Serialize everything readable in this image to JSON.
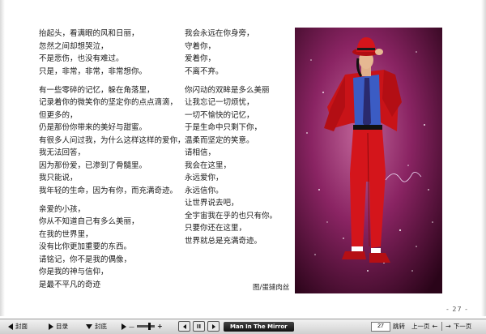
{
  "left_column": [
    [
      "抬起头，看满眼的风和日丽，",
      "忽然之间却想哭泣，",
      "不是悲伤，也没有难过。",
      "只是，非常，非常，非常想你。"
    ],
    [
      "有一些零碎的记忆，躲在角落里，",
      "记录着你的微笑你的坚定你的点点滴滴，",
      "但更多的，",
      "仍是那份你带来的美好与甜蜜。",
      "有很多人问过我，为什么这样这样的爱你，",
      "我无法回答，",
      "因为那份爱，已渗到了骨髓里。",
      "我只能说，",
      "我年轻的生命，因为有你，而充满奇迹。"
    ],
    [
      "亲爱的小孩，",
      "你从不知道自己有多么美丽，",
      "在我的世界里，",
      "没有比你更加重要的东西。",
      "请铭记，你不是我的偶像，",
      "你是我的神与信仰，",
      "是最不平凡的奇迹"
    ]
  ],
  "middle_column": [
    [
      "我会永远在你身旁，",
      "守着你，",
      "爱着你，",
      "不离不弃。"
    ],
    [
      "你闪动的双眸是多么美丽",
      "让我忘记一切烦忧，",
      "一切不愉快的记忆，",
      "于是生命中只剩下你，",
      "温柔而坚定的笑意。",
      "请相信，",
      "我会在这里，",
      "永远爱你，",
      "永远信你。",
      "让世界说去吧，",
      "全宇宙我在乎的也只有你。",
      "只要你还在这里，",
      "世界就总是充满奇迹。"
    ]
  ],
  "caption": "图/蛋撻肉丝",
  "page_number": "- 27 -",
  "toolbar": {
    "cover": "封面",
    "toc": "目录",
    "back_cover": "封底",
    "song": "Man In The Mirror",
    "page_input": "27",
    "jump": "跳转",
    "prev": "上一页",
    "next": "下一页"
  },
  "colors": {
    "art_bg": "#5a0f3a",
    "suit_red": "#d4151b",
    "shirt_blue": "#3b5cc4"
  }
}
